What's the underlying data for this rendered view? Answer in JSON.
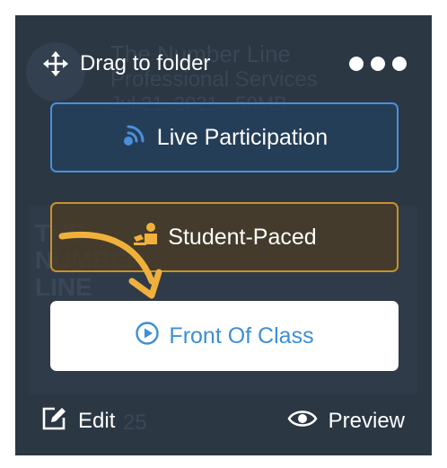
{
  "card": {
    "bg_title": "The Number Line",
    "bg_subtitle": "Professional Services",
    "bg_meta": "Jul 21, 2021 · 50MB",
    "bg_thumb_text": "THE\nNUMBER\nLINE",
    "bg_count": "25"
  },
  "top_bar": {
    "drag_label": "Drag to folder",
    "drag_icon": "move-arrows-icon",
    "more_icon": "more-dots-icon"
  },
  "modes": {
    "live_label": "Live Participation",
    "live_icon": "broadcast-icon",
    "student_label": "Student-Paced",
    "student_icon": "student-desk-icon",
    "front_label": "Front Of Class",
    "front_icon": "play-circle-icon"
  },
  "bottom_bar": {
    "edit_label": "Edit",
    "edit_icon": "edit-icon",
    "preview_label": "Preview",
    "preview_icon": "eye-icon"
  },
  "colors": {
    "card_bg": "#2b3743",
    "live_border": "#4a90d9",
    "student_border": "#c9902a",
    "front_text": "#3d8fd6",
    "arrow": "#f0b13c"
  }
}
